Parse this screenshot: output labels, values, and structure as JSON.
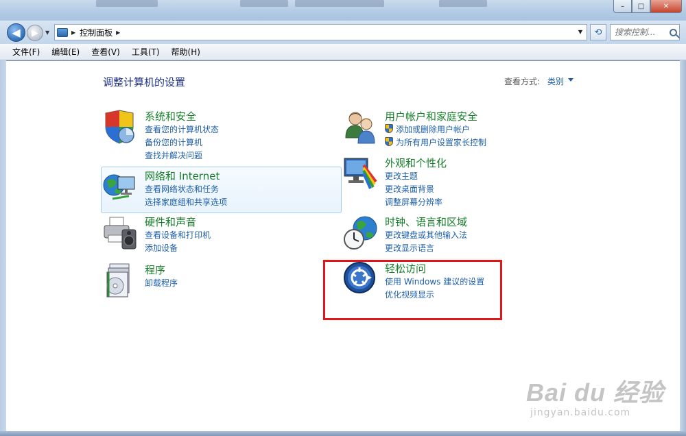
{
  "window": {
    "buttons": {
      "minimize": "–",
      "maximize": "□",
      "close": "✕"
    }
  },
  "nav": {
    "back_glyph": "◀",
    "forward_glyph": "▶",
    "breadcrumb": [
      "控制面板"
    ],
    "breadcrumb_sep": "▶",
    "refresh_glyph": "⟲",
    "search_placeholder": "搜索控制...",
    "dropdown_glyph": "▼"
  },
  "menu": [
    "文件(F)",
    "编辑(E)",
    "查看(V)",
    "工具(T)",
    "帮助(H)"
  ],
  "main": {
    "title": "调整计算机的设置",
    "view_by_label": "查看方式:",
    "view_by_value": "类别",
    "categories": [
      {
        "name": "系统和安全",
        "icon": "shield-pie-icon",
        "links": [
          "查看您的计算机状态",
          "备份您的计算机",
          "查找并解决问题"
        ]
      },
      {
        "name": "网络和 Internet",
        "icon": "network-globe-icon",
        "links": [
          "查看网络状态和任务",
          "选择家庭组和共享选项"
        ]
      },
      {
        "name": "硬件和声音",
        "icon": "printer-speaker-icon",
        "links": [
          "查看设备和打印机",
          "添加设备"
        ]
      },
      {
        "name": "程序",
        "icon": "programs-disc-icon",
        "links": [
          "卸载程序"
        ]
      },
      {
        "name": "用户帐户和家庭安全",
        "icon": "users-icon",
        "links": [
          "添加或删除用户帐户",
          "为所有用户设置家长控制"
        ],
        "shield_links": true
      },
      {
        "name": "外观和个性化",
        "icon": "monitor-palette-icon",
        "links": [
          "更改主题",
          "更改桌面背景",
          "调整屏幕分辨率"
        ]
      },
      {
        "name": "时钟、语言和区域",
        "icon": "clock-globe-icon",
        "links": [
          "更改键盘或其他输入法",
          "更改显示语言"
        ]
      },
      {
        "name": "轻松访问",
        "icon": "ease-of-access-icon",
        "links": [
          "使用 Windows 建议的设置",
          "优化视频显示"
        ]
      }
    ]
  },
  "watermark": {
    "main": "Bai du 经验",
    "url": "jingyan.baidu.com"
  },
  "colors": {
    "category": "#177f2a",
    "link": "#1e5fa8",
    "title": "#1e3287",
    "highlight": "#e0161b"
  }
}
